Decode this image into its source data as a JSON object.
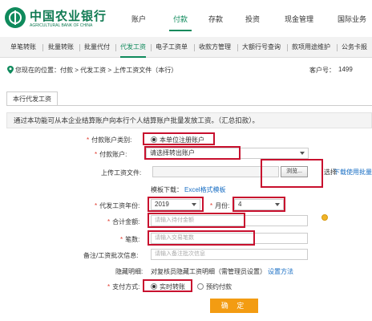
{
  "logo": {
    "cn": "中国农业银行",
    "en": "AGRICULTURAL BANK OF CHINA"
  },
  "main_nav": [
    "账户",
    "付款",
    "存款",
    "投资",
    "现金管理",
    "国际业务"
  ],
  "sub_nav": [
    "单笔转账",
    "批量转账",
    "批量代付",
    "代发工资",
    "电子工资单",
    "收款方管理",
    "大额行号查询",
    "款项用途维护",
    "公务卡报"
  ],
  "breadcrumb": "您现在的位置：付款 > 代发工资 > 上传工资文件（本行）",
  "customer": {
    "label": "客户号：",
    "value": "1499"
  },
  "panel_tab": "本行代发工资",
  "intro": "通过本功能可从本企业结算账户向本行个人结算账户批量发放工资。（汇总扣款）。",
  "form": {
    "payer_type": {
      "label": "付款账户类别:",
      "option": "本单位注册账户"
    },
    "payer_account": {
      "label": "付款账户:",
      "value": "请选择转出账户"
    },
    "upload": {
      "label": "上传工资文件:",
      "browse": "浏览...",
      "trailing": "选择",
      "batch_link": "下载使用批量"
    },
    "template": {
      "label": "模板下载：",
      "link": "Excel格式模板"
    },
    "year": {
      "label": "代发工资年份:",
      "value": "2019"
    },
    "month": {
      "label": "月份:",
      "value": "4"
    },
    "total": {
      "label": "合计金额:",
      "placeholder": "请输入待付金额"
    },
    "count": {
      "label": "笔数:",
      "placeholder": "请输入交易笔数"
    },
    "remark": {
      "label": "备注/工资批次信息:",
      "placeholder": "请输入备注批次信息"
    },
    "hidden": {
      "label": "隐藏明细:",
      "text": "对复核员隐藏工资明细（需管理员设置）",
      "link": "设置方法"
    },
    "pay_method": {
      "label": "支付方式:",
      "option1": "实时转账",
      "option2": "预约付款"
    },
    "confirm": "确 定"
  },
  "colors": {
    "brand_green": "#0f8a5c",
    "highlight_red": "#c8102e",
    "button_orange": "#f39c12",
    "link_blue": "#1a6fc4"
  }
}
